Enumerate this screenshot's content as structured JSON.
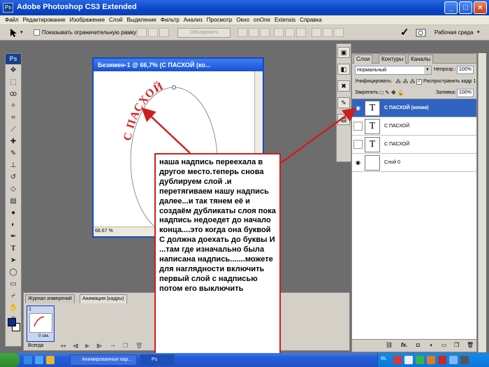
{
  "window": {
    "app_icon": "Ps",
    "title": "Adobe Photoshop CS3 Extended",
    "buttons": [
      "minimize",
      "maximize",
      "close"
    ]
  },
  "menu": [
    "Файл",
    "Редактирование",
    "Изображение",
    "Слой",
    "Выделение",
    "Фильтр",
    "Анализ",
    "Просмотр",
    "Окно",
    "onOne",
    "Extensis",
    "Справка"
  ],
  "options_bar": {
    "show_bounds_label": "Показывать ограничительную рамку",
    "show_bounds_checked": false,
    "merge_button": "Объединить",
    "workspace_label": "Рабочая среда"
  },
  "toolbox": {
    "logo": "Ps",
    "tools": [
      "move",
      "marquee",
      "lasso",
      "magic-wand",
      "crop",
      "slice",
      "healing",
      "brush",
      "stamp",
      "history-brush",
      "eraser",
      "gradient",
      "blur",
      "dodge",
      "pen",
      "type",
      "path-select",
      "shape",
      "notes",
      "eyedropper",
      "hand",
      "zoom"
    ],
    "foreground_color": "#0a2e8a",
    "background_color": "#ffffff"
  },
  "document": {
    "title": "Безимен-1 @ 66,7% (С ПАСХОЙ (ко...",
    "zoom": "66,67 %",
    "curved_text": "С ПАСХОЙ",
    "text_color": "#d62020"
  },
  "layers_panel": {
    "tabs": [
      "Слои",
      "Контуры",
      "Каналы"
    ],
    "active_tab": "Слои",
    "blend_mode": "Нормальный",
    "opacity_label": "Непрозр.:",
    "opacity": "100%",
    "unify_label": "Унифицировать:",
    "propagate_label": "Распространить кадр 1",
    "propagate_checked": true,
    "lock_label": "Закрепить:",
    "fill_label": "Заливка:",
    "fill": "100%",
    "layers": [
      {
        "name": "С ПАСХОЙ (копия)",
        "thumb": "T",
        "visible": true,
        "selected": true
      },
      {
        "name": "С ПАСХОЙ",
        "thumb": "T",
        "visible": false,
        "selected": false
      },
      {
        "name": "С ПАСХОЙ",
        "thumb": "T",
        "visible": false,
        "selected": false
      },
      {
        "name": "Слой 0",
        "thumb": "",
        "visible": true,
        "selected": false
      }
    ]
  },
  "animation_panel": {
    "tabs": [
      "Журнал измерений",
      "Анимация (кадры)"
    ],
    "active_tab": "Анимация (кадры)",
    "frame_number": "1",
    "frame_delay": "0 сек.",
    "loop": "Всегда"
  },
  "callout": {
    "text": "наша надпись переехала в другое место.теперь снова дублируем слой .и перетягиваем нашу надпись далее...и так тянем её и создаём дубликаты слоя пока надпись недоедет до начало конца....это когда она буквой С должна доехать до буквы И ...там где изначально была написана надпись.......можете для наглядности включить первый слой с надписью потом его выключить",
    "border_color": "#cc1f1f",
    "arrow_color": "#cc1f1f"
  },
  "taskbar": {
    "items": [
      "Анимированные кар...",
      "Ps"
    ],
    "tray_lang": "RL"
  }
}
